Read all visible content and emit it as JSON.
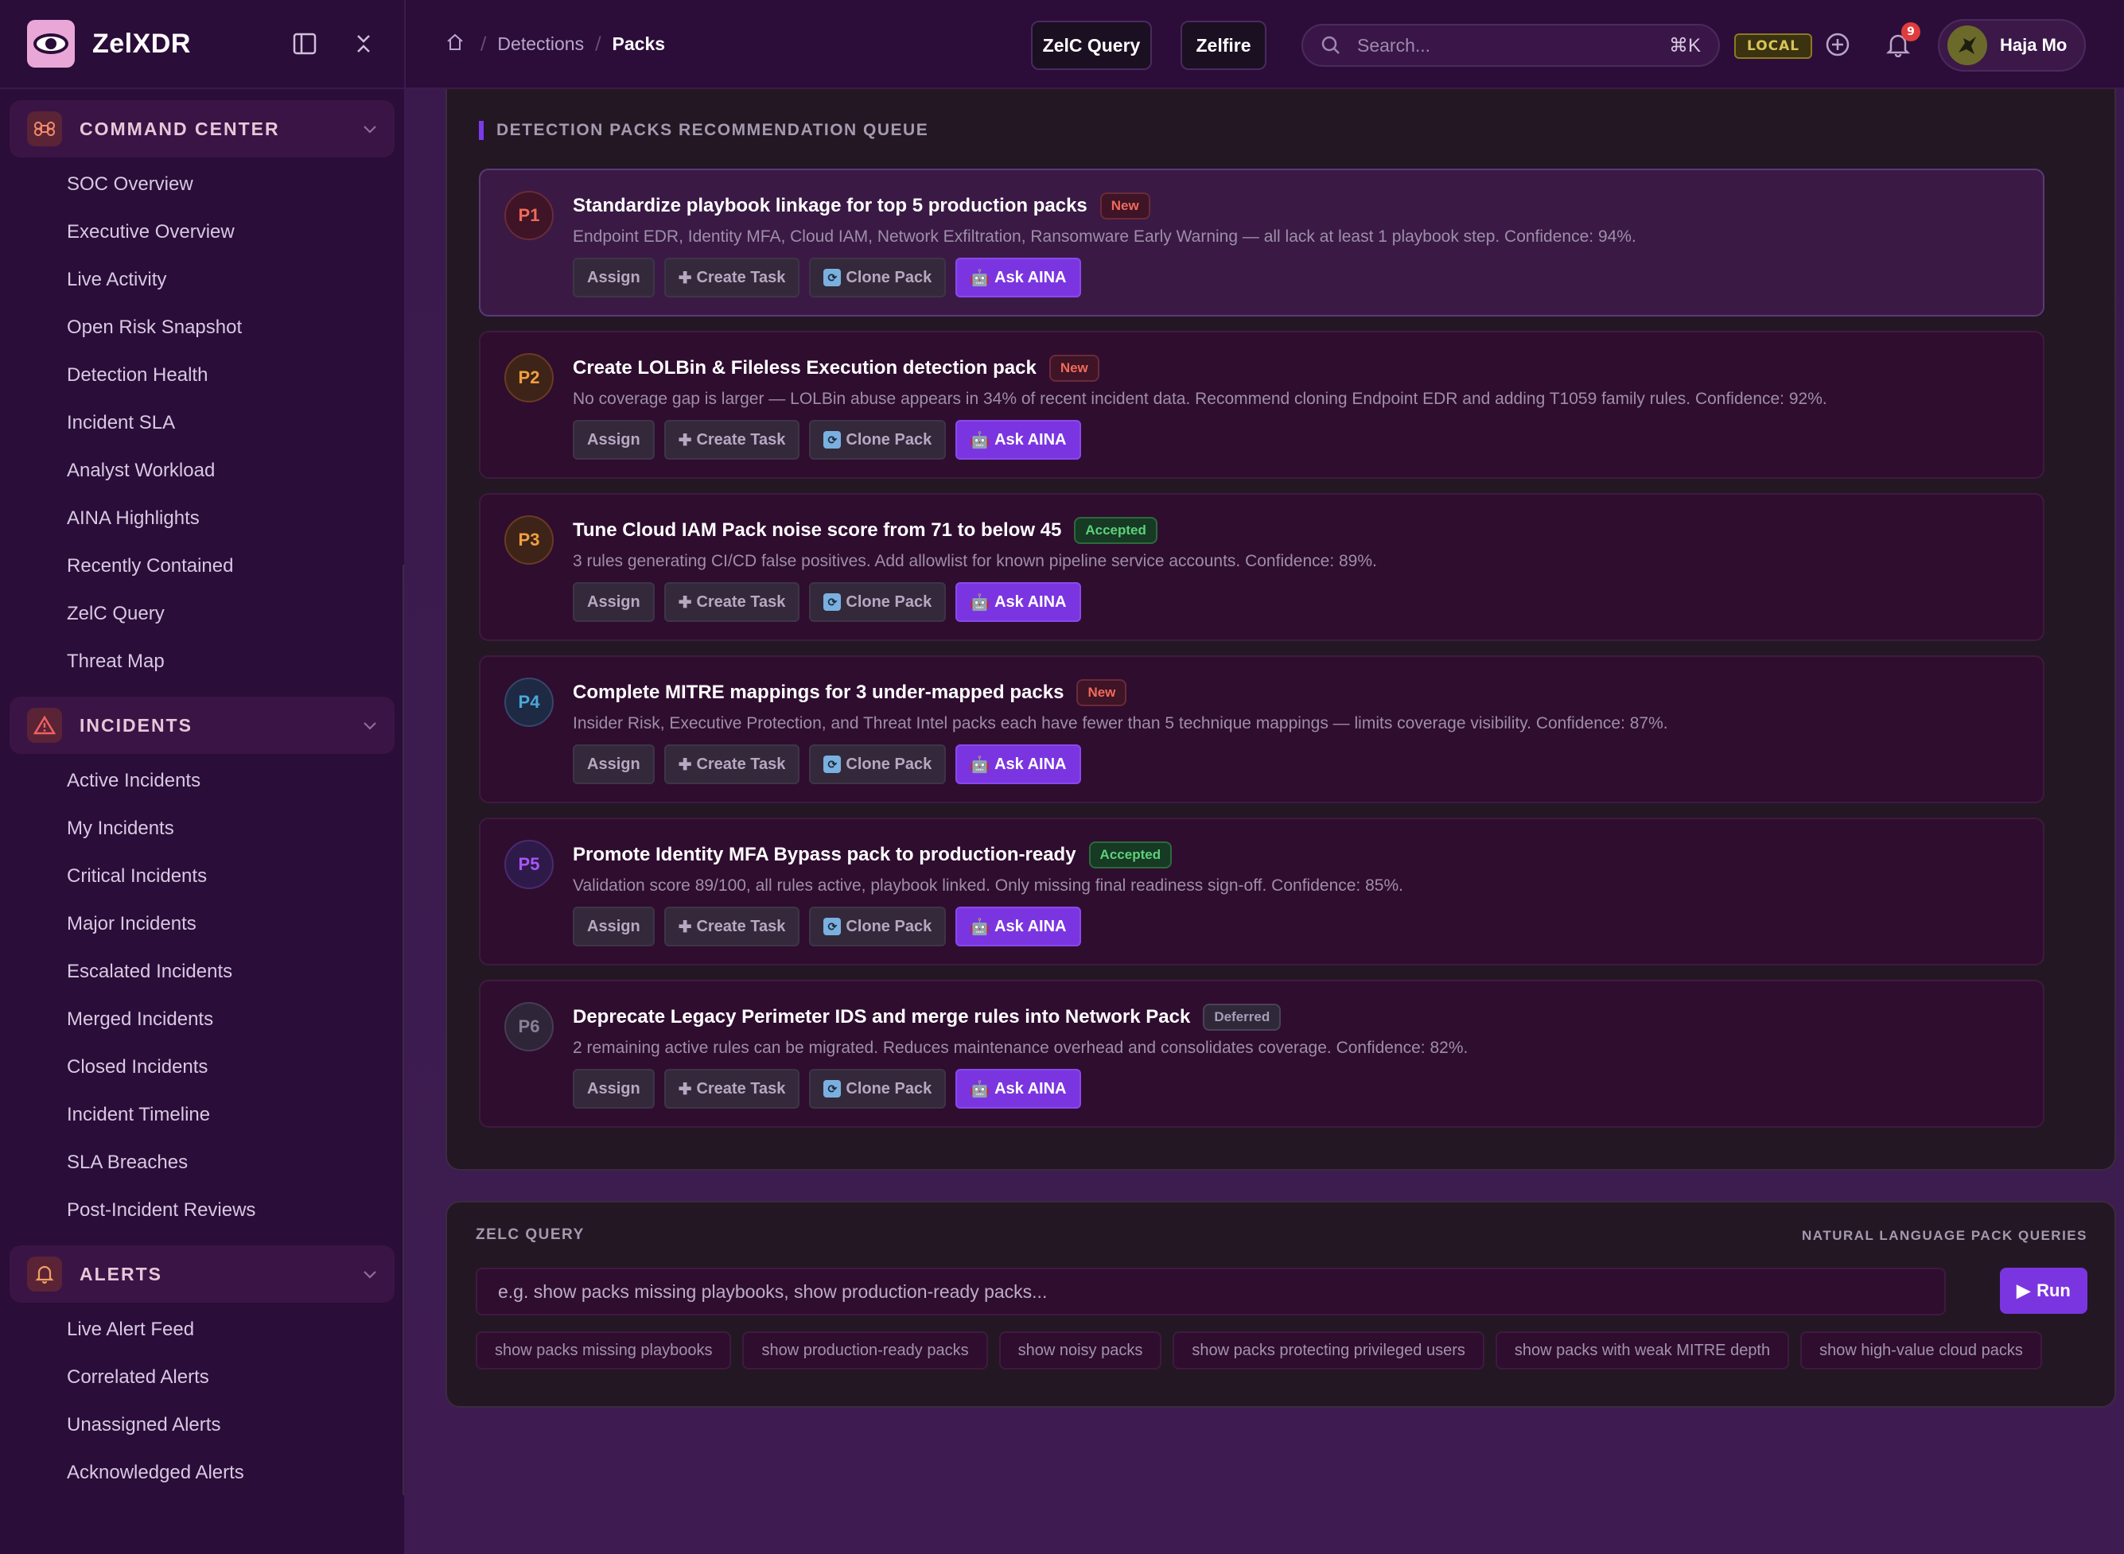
{
  "brand": {
    "name": "ZelXDR"
  },
  "sidebar": {
    "sections": [
      {
        "label": "COMMAND CENTER",
        "icon": "command-icon",
        "items": [
          "SOC Overview",
          "Executive Overview",
          "Live Activity",
          "Open Risk Snapshot",
          "Detection Health",
          "Incident SLA",
          "Analyst Workload",
          "AINA Highlights",
          "Recently Contained",
          "ZelC Query",
          "Threat Map"
        ]
      },
      {
        "label": "INCIDENTS",
        "icon": "warning-triangle-icon",
        "items": [
          "Active Incidents",
          "My Incidents",
          "Critical Incidents",
          "Major Incidents",
          "Escalated Incidents",
          "Merged Incidents",
          "Closed Incidents",
          "Incident Timeline",
          "SLA Breaches",
          "Post-Incident Reviews"
        ]
      },
      {
        "label": "ALERTS",
        "icon": "bell-icon",
        "items": [
          "Live Alert Feed",
          "Correlated Alerts",
          "Unassigned Alerts",
          "Acknowledged Alerts"
        ]
      }
    ]
  },
  "topbar": {
    "breadcrumb": [
      "Detections",
      "Packs"
    ],
    "zelc_query_label": "ZelC Query",
    "zelfire_label": "Zelfire",
    "search_placeholder": "Search...",
    "search_shortcut": "⌘K",
    "env_badge": "LOCAL",
    "notification_count": "9",
    "user_name": "Haja Mo"
  },
  "queue": {
    "title": "DETECTION PACKS RECOMMENDATION QUEUE",
    "actions": {
      "assign": "Assign",
      "create_task": "Create Task",
      "clone_pack": "Clone Pack",
      "ask_aina": "Ask AINA"
    },
    "items": [
      {
        "priority": "P1",
        "title": "Standardize playbook linkage for top 5 production packs",
        "status": "New",
        "desc": "Endpoint EDR, Identity MFA, Cloud IAM, Network Exfiltration, Ransomware Early Warning — all lack at least 1 playbook step. Confidence: 94%."
      },
      {
        "priority": "P2",
        "title": "Create LOLBin & Fileless Execution detection pack",
        "status": "New",
        "desc": "No coverage gap is larger — LOLBin abuse appears in 34% of recent incident data. Recommend cloning Endpoint EDR and adding T1059 family rules. Confidence: 92%."
      },
      {
        "priority": "P3",
        "title": "Tune Cloud IAM Pack noise score from 71 to below 45",
        "status": "Accepted",
        "desc": "3 rules generating CI/CD false positives. Add allowlist for known pipeline service accounts. Confidence: 89%."
      },
      {
        "priority": "P4",
        "title": "Complete MITRE mappings for 3 under-mapped packs",
        "status": "New",
        "desc": "Insider Risk, Executive Protection, and Threat Intel packs each have fewer than 5 technique mappings — limits coverage visibility. Confidence: 87%."
      },
      {
        "priority": "P5",
        "title": "Promote Identity MFA Bypass pack to production-ready",
        "status": "Accepted",
        "desc": "Validation score 89/100, all rules active, playbook linked. Only missing final readiness sign-off. Confidence: 85%."
      },
      {
        "priority": "P6",
        "title": "Deprecate Legacy Perimeter IDS and merge rules into Network Pack",
        "status": "Deferred",
        "desc": "2 remaining active rules can be migrated. Reduces maintenance overhead and consolidates coverage. Confidence: 82%."
      }
    ]
  },
  "zelc_query": {
    "title": "ZELC QUERY",
    "subtitle": "NATURAL LANGUAGE PACK QUERIES",
    "placeholder": "e.g. show packs missing playbooks, show production-ready packs...",
    "run_label": "Run",
    "chips": [
      "show packs missing playbooks",
      "show production-ready packs",
      "show noisy packs",
      "show packs protecting privileged users",
      "show packs with weak MITRE depth",
      "show high-value cloud packs"
    ]
  },
  "colors": {
    "accent": "#7b35e0",
    "p1": "#f06a5a",
    "p2": "#f0a040",
    "p3": "#f0a040",
    "p4": "#4aa8d8",
    "p5": "#a855f7",
    "p6": "#8a7e98"
  }
}
